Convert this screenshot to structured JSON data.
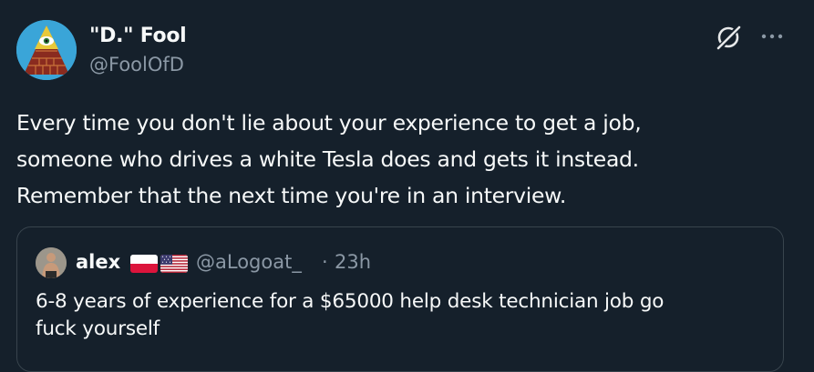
{
  "author": {
    "display_name": "\"D.\" Fool",
    "handle": "@FoolOfD",
    "avatar_icon": "eye-pyramid-avatar"
  },
  "header_actions": {
    "grok_icon": "grok-icon",
    "more_icon": "more-icon"
  },
  "tweet": {
    "text": "Every time you don't lie about your experience to get a job,\nsomeone who drives a white Tesla does and gets it instead.\nRemember that the next time you're in an interview."
  },
  "quoted_tweet": {
    "display_name": "alex",
    "flags": [
      "flag-poland-icon",
      "flag-usa-icon"
    ],
    "handle": "@aLogoat_",
    "separator": "·",
    "time": "23h",
    "text": "6-8 years of experience for a $65000 help desk technician job go\nfuck yourself"
  },
  "colors": {
    "background": "#15202b",
    "primary_text": "#f7f9f9",
    "secondary_text": "#8b98a5",
    "border": "#38444d"
  }
}
